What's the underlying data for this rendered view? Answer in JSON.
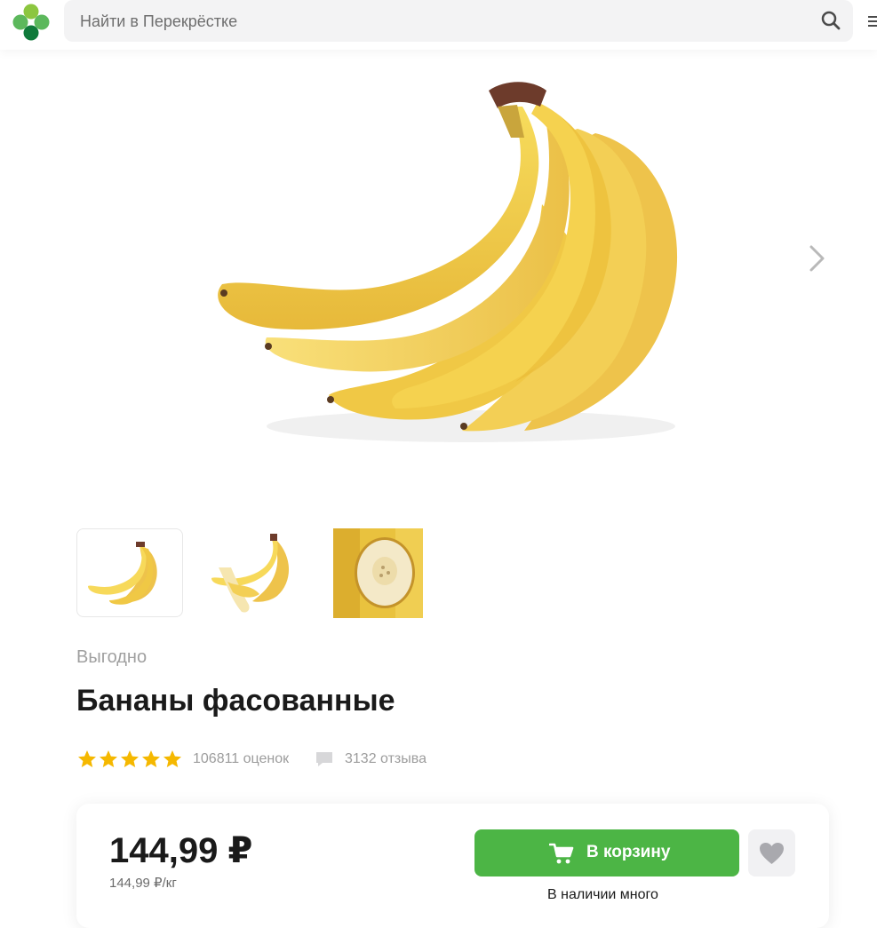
{
  "header": {
    "search": {
      "placeholder": "Найти в Перекрёстке"
    }
  },
  "icons": {
    "logo": "clover-logo",
    "search": "search-icon",
    "menu": "menu-icon",
    "next": "chevron-right-icon",
    "star": "star-icon",
    "reviews": "comment-icon",
    "cart": "cart-icon",
    "favorite": "heart-icon"
  },
  "colors": {
    "brand_green": "#4cb545",
    "star": "#f5b800",
    "muted_text": "#9d9d9d"
  },
  "gallery": {
    "thumbnails": [
      "banana-bunch",
      "peeled-banana",
      "banana-slice"
    ],
    "selected_index": 0
  },
  "product": {
    "promo_label": "Выгодно",
    "title": "Бананы фасованные",
    "rating": {
      "stars": 5,
      "count_text": "106811 оценок"
    },
    "reviews": {
      "count_text": "3132 отзыва"
    }
  },
  "price_card": {
    "price": "144,99 ₽",
    "unit_price": "144,99 ₽/кг",
    "add_to_cart_label": "В корзину",
    "availability": "В наличии много"
  }
}
